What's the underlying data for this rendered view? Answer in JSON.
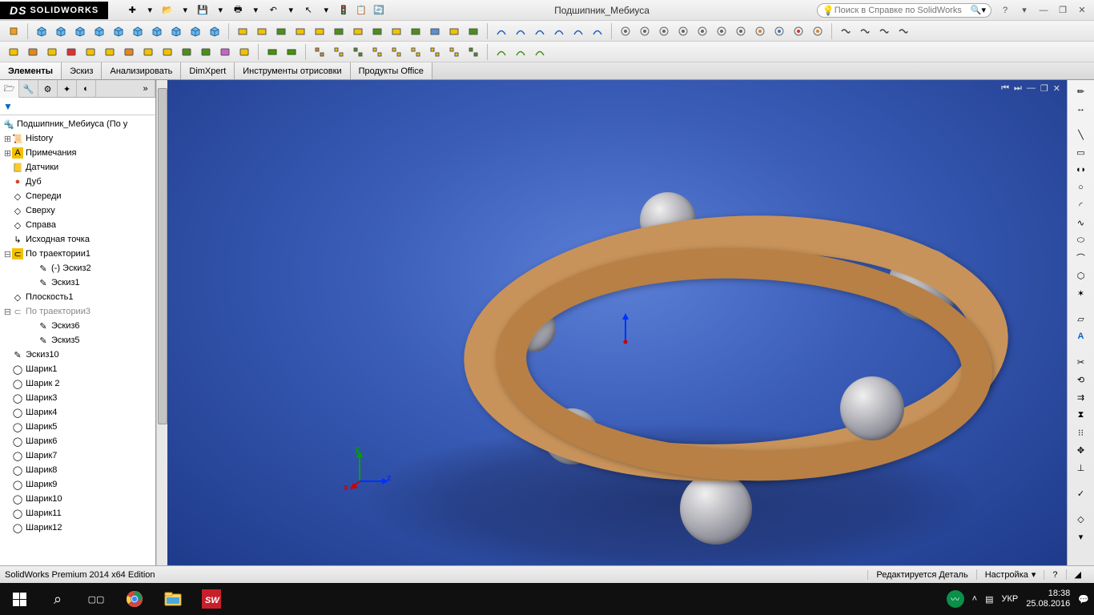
{
  "app": {
    "logo_prefix": "DS",
    "logo_name": "SOLIDWORKS"
  },
  "doc_title": "Подшипник_Мебиуса",
  "search": {
    "placeholder": "Поиск в Справке по SolidWorks"
  },
  "toolbar_icons": {
    "new": "✚",
    "open": "📂",
    "save": "💾",
    "print": "🖶",
    "undo": "↶",
    "select": "↖",
    "light": "🚦",
    "opts": "📋",
    "rebuild": "🔄"
  },
  "tabs": [
    "Элементы",
    "Эскиз",
    "Анализировать",
    "DimXpert",
    "Инструменты отрисовки",
    "Продукты Office"
  ],
  "active_tab": 0,
  "tree": {
    "root": "Подшипник_Мебиуса  (По у",
    "items": [
      {
        "icon": "📜",
        "label": "History",
        "exp": "+",
        "ind": 0
      },
      {
        "icon": "A",
        "label": "Примечания",
        "exp": "+",
        "ind": 0,
        "iconbg": "#f2c200"
      },
      {
        "icon": "📒",
        "label": "Датчики",
        "ind": 0
      },
      {
        "icon": "●",
        "label": "Дуб",
        "ind": 0,
        "color": "#d04728"
      },
      {
        "icon": "◇",
        "label": "Спереди",
        "ind": 0
      },
      {
        "icon": "◇",
        "label": "Сверху",
        "ind": 0
      },
      {
        "icon": "◇",
        "label": "Справа",
        "ind": 0
      },
      {
        "icon": "↳",
        "label": "Исходная точка",
        "ind": 0
      },
      {
        "icon": "⊂",
        "label": "По траектории1",
        "exp": "-",
        "ind": 0,
        "iconbg": "#f2c200"
      },
      {
        "icon": "✎",
        "label": "(-) Эскиз2",
        "ind": 2
      },
      {
        "icon": "✎",
        "label": "Эскиз1",
        "ind": 2
      },
      {
        "icon": "◇",
        "label": "Плоскость1",
        "ind": 0
      },
      {
        "icon": "⊂",
        "label": "По траектории3",
        "exp": "-",
        "ind": 0,
        "gray": true
      },
      {
        "icon": "✎",
        "label": "Эскиз6",
        "ind": 2
      },
      {
        "icon": "✎",
        "label": "Эскиз5",
        "ind": 2
      },
      {
        "icon": "✎",
        "label": "Эскиз10",
        "ind": 0
      },
      {
        "icon": "◯",
        "label": "Шарик1",
        "ind": 0
      },
      {
        "icon": "◯",
        "label": "Шарик 2",
        "ind": 0
      },
      {
        "icon": "◯",
        "label": "Шарик3",
        "ind": 0
      },
      {
        "icon": "◯",
        "label": "Шарик4",
        "ind": 0
      },
      {
        "icon": "◯",
        "label": "Шарик5",
        "ind": 0
      },
      {
        "icon": "◯",
        "label": "Шарик6",
        "ind": 0
      },
      {
        "icon": "◯",
        "label": "Шарик7",
        "ind": 0
      },
      {
        "icon": "◯",
        "label": "Шарик8",
        "ind": 0
      },
      {
        "icon": "◯",
        "label": "Шарик9",
        "ind": 0
      },
      {
        "icon": "◯",
        "label": "Шарик10",
        "ind": 0
      },
      {
        "icon": "◯",
        "label": "Шарик11",
        "ind": 0
      },
      {
        "icon": "◯",
        "label": "Шарик12",
        "ind": 0
      }
    ]
  },
  "axes": {
    "x": "x",
    "y": "y",
    "z": "z"
  },
  "status": {
    "left": "SolidWorks Premium 2014 x64 Edition",
    "mode": "Редактируется Деталь",
    "setting": "Настройка",
    "help": "?"
  },
  "taskbar": {
    "lang": "УКР",
    "time": "18:38",
    "date": "25.08.2016"
  }
}
